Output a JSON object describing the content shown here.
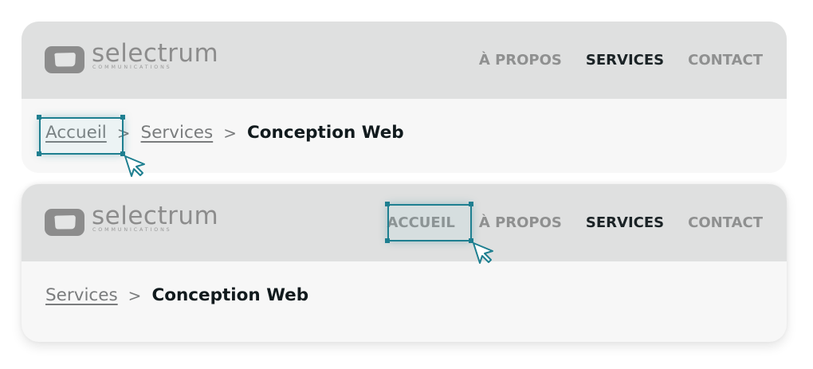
{
  "brand": {
    "name": "selectrum",
    "tagline": "COMMUNICATIONS",
    "colors": {
      "header_bg": "#dfe0e0",
      "body_bg": "#f7f7f7",
      "accent": "#1e7f90",
      "text_dark": "#1b2326",
      "text_muted": "#8f9090"
    }
  },
  "variant_a": {
    "nav": [
      {
        "label": "À PROPOS",
        "active": false
      },
      {
        "label": "SERVICES",
        "active": true
      },
      {
        "label": "CONTACT",
        "active": false
      }
    ],
    "breadcrumb": {
      "links": [
        "Accueil",
        "Services"
      ],
      "separator": ">",
      "current": "Conception Web"
    },
    "highlight_target": "Accueil"
  },
  "variant_b": {
    "nav": [
      {
        "label": "ACCUEIL",
        "active": false
      },
      {
        "label": "À PROPOS",
        "active": false
      },
      {
        "label": "SERVICES",
        "active": true
      },
      {
        "label": "CONTACT",
        "active": false
      }
    ],
    "breadcrumb": {
      "links": [
        "Services"
      ],
      "separator": ">",
      "current": "Conception Web"
    },
    "highlight_target": "ACCUEIL"
  },
  "icons": {
    "logo": "rounded-square-logo-icon",
    "cursor": "pointer-cursor-icon",
    "separator": "chevron-right-icon"
  }
}
